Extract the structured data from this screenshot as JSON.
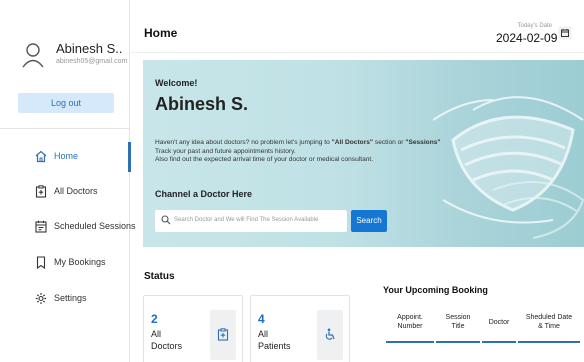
{
  "sidebar": {
    "profile": {
      "name": "Abinesh S..",
      "email": "abinesh05@gmail.com"
    },
    "logout_label": "Log out",
    "items": [
      {
        "label": "Home",
        "icon": "home-icon",
        "active": true
      },
      {
        "label": "All Doctors",
        "icon": "doctor-icon",
        "active": false
      },
      {
        "label": "Scheduled Sessions",
        "icon": "schedule-icon",
        "active": false
      },
      {
        "label": "My Bookings",
        "icon": "bookmark-icon",
        "active": false
      },
      {
        "label": "Settings",
        "icon": "gear-icon",
        "active": false
      }
    ]
  },
  "header": {
    "title": "Home",
    "date_label": "Today's Date",
    "date_value": "2024-02-09",
    "calendar_icon": "calendar-icon"
  },
  "banner": {
    "welcome": "Welcome!",
    "user_name": "Abinesh S.",
    "desc_pre": "Haven't any idea about doctors? no problem let's jumping to ",
    "desc_link1": "\"All Doctors\"",
    "desc_mid": " section or ",
    "desc_link2": "\"Sessions\"",
    "desc_line2": "Track your past and future appointments history.",
    "desc_line3": "Also find out the expected arrival time of your doctor or medical consultant.",
    "channel_title": "Channel a Doctor Here",
    "search_placeholder": "Search Doctor and We will Find The Session Available",
    "search_button": "Search"
  },
  "status": {
    "title": "Status",
    "cards": [
      {
        "count": "2",
        "line1": "All",
        "line2": "Doctors",
        "icon": "doctor-icon"
      },
      {
        "count": "4",
        "line1": "All",
        "line2": "Patients",
        "icon": "wheelchair-icon"
      }
    ]
  },
  "upcoming": {
    "title": "Your Upcoming Booking",
    "columns": [
      {
        "l1": "Appoint.",
        "l2": "Number"
      },
      {
        "l1": "Session",
        "l2": "Title"
      },
      {
        "l1": "Doctor",
        "l2": ""
      },
      {
        "l1": "Sheduled Date",
        "l2": "& Time"
      }
    ]
  },
  "colors": {
    "accent": "#2d6fb6",
    "search_button": "#1677d2",
    "logout_bg": "#d6e9fb"
  }
}
